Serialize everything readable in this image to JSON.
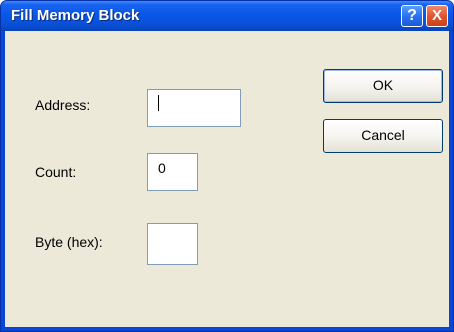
{
  "dialog": {
    "title": "Fill Memory Block",
    "titlebar_buttons": {
      "help": "?",
      "close": "X"
    }
  },
  "form": {
    "address_label": "Address:",
    "address_value": "",
    "count_label": "Count:",
    "count_value": "0",
    "byte_label": "Byte (hex):",
    "byte_value": ""
  },
  "buttons": {
    "ok": "OK",
    "cancel": "Cancel"
  },
  "icons": [
    "help-icon",
    "close-icon"
  ],
  "colors": {
    "titlebar": "#0858e8",
    "client_bg": "#ece9d8",
    "close_button": "#e2552e"
  }
}
